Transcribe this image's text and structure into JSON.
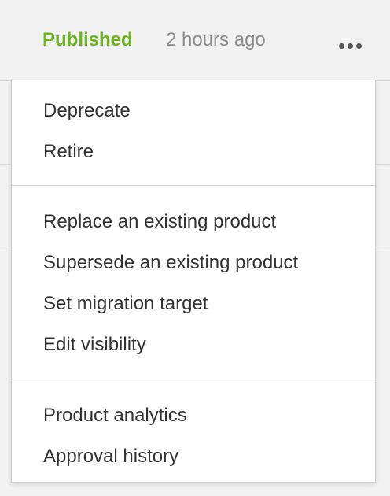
{
  "header": {
    "status": "Published",
    "time": "2 hours ago",
    "more_icon": "more-horizontal-icon"
  },
  "menu": {
    "groups": [
      {
        "items": [
          "Deprecate",
          "Retire"
        ]
      },
      {
        "items": [
          "Replace an existing product",
          "Supersede an existing product",
          "Set migration target",
          "Edit visibility"
        ]
      },
      {
        "items": [
          "Product analytics",
          "Approval history"
        ]
      }
    ]
  },
  "colors": {
    "status_green": "#6cb521",
    "muted_text": "#8c8c8c",
    "menu_text": "#333333"
  }
}
